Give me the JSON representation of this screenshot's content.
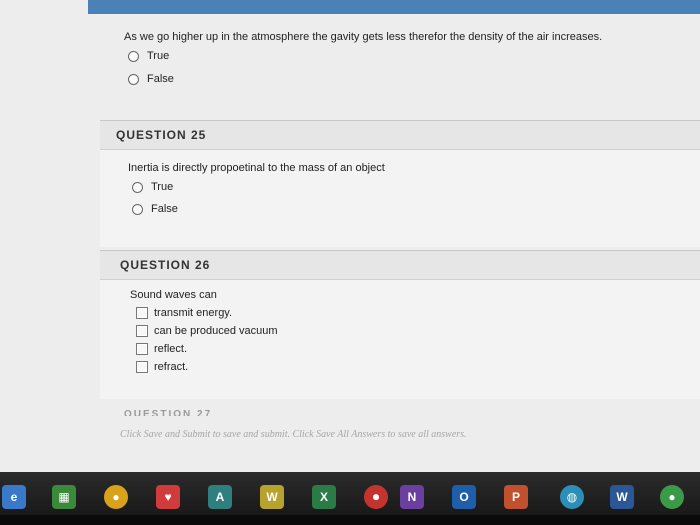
{
  "q24": {
    "text": "As we go higher up in the atmosphere the gavity gets less therefor the density of the air increases.",
    "options": [
      "True",
      "False"
    ]
  },
  "q25": {
    "header": "QUESTION 25",
    "text": "Inertia is directly propoetinal to the mass of an object",
    "options": [
      "True",
      "False"
    ]
  },
  "q26": {
    "header": "QUESTION 26",
    "text": "Sound waves can",
    "options": [
      "transmit energy.",
      "can be produced vacuum",
      "reflect.",
      "refract."
    ]
  },
  "q27": {
    "header": "QUESTION 27"
  },
  "footer": {
    "text": "Click Save and Submit to save and submit. Click Save All Answers to save all answers."
  },
  "taskbar": {
    "icons": [
      {
        "name": "edge-icon",
        "glyph": "e",
        "color": "#3a78c9"
      },
      {
        "name": "store-icon",
        "glyph": "▦",
        "color": "#3b8a3b"
      },
      {
        "name": "chrome-icon",
        "glyph": "●",
        "color": "#d9a21b"
      },
      {
        "name": "app-red-icon",
        "glyph": "♥",
        "color": "#d23b3b"
      },
      {
        "name": "access-icon",
        "glyph": "A",
        "color": "#2f7f7f"
      },
      {
        "name": "publisher-icon",
        "glyph": "W",
        "color": "#b7a22d"
      },
      {
        "name": "excel-icon",
        "glyph": "X",
        "color": "#2a7b45"
      },
      {
        "name": "record-icon",
        "glyph": "⏺",
        "color": "#c4342f"
      },
      {
        "name": "onenote-icon",
        "glyph": "N",
        "color": "#6b3fa0"
      },
      {
        "name": "outlook-icon",
        "glyph": "O",
        "color": "#1f5ea8"
      },
      {
        "name": "powerpoint-icon",
        "glyph": "P",
        "color": "#c1502e"
      },
      {
        "name": "globe-icon",
        "glyph": "◍",
        "color": "#2b8fb8"
      },
      {
        "name": "word-icon",
        "glyph": "W",
        "color": "#2b5797"
      },
      {
        "name": "chrome2-icon",
        "glyph": "●",
        "color": "#3a9a47"
      }
    ]
  }
}
